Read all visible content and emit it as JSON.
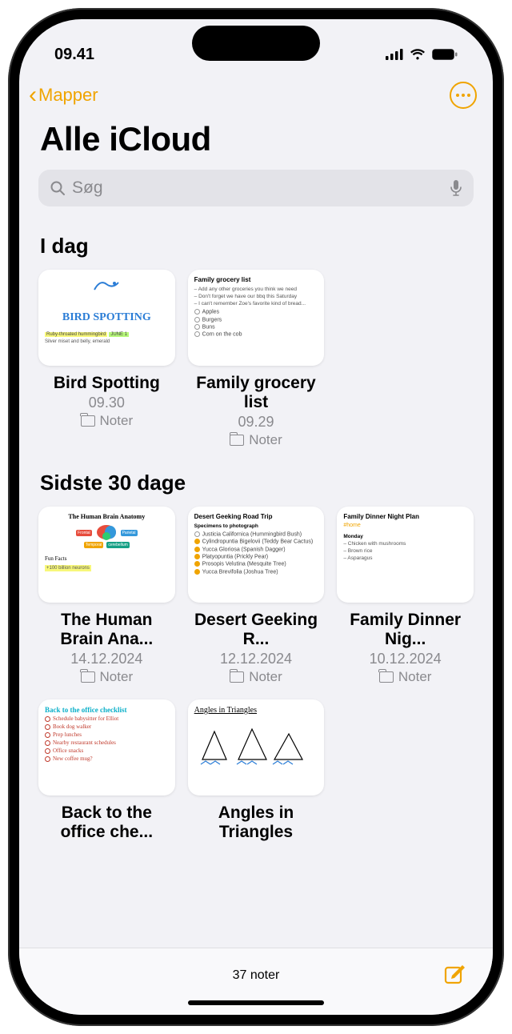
{
  "status": {
    "time": "09.41"
  },
  "nav": {
    "back_label": "Mapper"
  },
  "title": "Alle iCloud",
  "search": {
    "placeholder": "Søg"
  },
  "sections": {
    "today": {
      "header": "I dag"
    },
    "recent": {
      "header": "Sidste 30 dage"
    }
  },
  "notes": {
    "today": [
      {
        "title": "Bird Spotting",
        "time": "09.30",
        "folder": "Noter",
        "preview": {
          "heading": "BIRD SPOTTING",
          "hl1": "Ruby-throated hummingbird",
          "hl2": "JUNE 1",
          "line": "Silver miset and belly, emerald"
        }
      },
      {
        "title": "Family grocery list",
        "time": "09.29",
        "folder": "Noter",
        "preview": {
          "heading": "Family grocery list",
          "bullets": [
            "Add any other groceries you think we need",
            "Don't forget we have our bbq this Saturday",
            "I can't remember Zoe's favorite kind of bread..."
          ],
          "checks": [
            "Apples",
            "Burgers",
            "Buns",
            "Corn on the cob"
          ]
        }
      }
    ],
    "recent": [
      {
        "title": "The Human Brain Ana...",
        "time": "14.12.2024",
        "folder": "Noter",
        "preview": {
          "heading": "The Human Brain Anatomy",
          "sub": "Fun Facts",
          "fact": "+100 billion neurons"
        }
      },
      {
        "title": "Desert Geeking R...",
        "time": "12.12.2024",
        "folder": "Noter",
        "preview": {
          "heading": "Desert Geeking Road Trip",
          "sub": "Specimens to photograph",
          "items": [
            "Justicia Californica (Hummingbird Bush)",
            "Cylindropuntia Bigelovii (Teddy Bear Cactus)",
            "Yucca Gloriosa (Spanish Dagger)",
            "Platyopuntia (Prickly Pear)",
            "Prosopis Velutina (Mesquite Tree)",
            "Yucca Brevifolia (Joshua Tree)"
          ]
        }
      },
      {
        "title": "Family Dinner Nig...",
        "time": "10.12.2024",
        "folder": "Noter",
        "preview": {
          "heading": "Family Dinner Night Plan",
          "tag": "#home",
          "day": "Monday",
          "items": [
            "Chicken with mushrooms",
            "Brown rice",
            "Asparagus"
          ]
        }
      },
      {
        "title": "Back to the office che...",
        "time": "",
        "folder": "",
        "preview": {
          "heading": "Back to the office checklist",
          "items": [
            "Schedule babysitter for Elliot",
            "Book dog walker",
            "Prep lunches",
            "Nearby restaurant schedules",
            "Office snacks",
            "New coffee mug?"
          ]
        }
      },
      {
        "title": "Angles in Triangles",
        "time": "",
        "folder": "",
        "preview": {
          "heading": "Angles in Triangles"
        }
      }
    ]
  },
  "toolbar": {
    "count": "37 noter"
  }
}
